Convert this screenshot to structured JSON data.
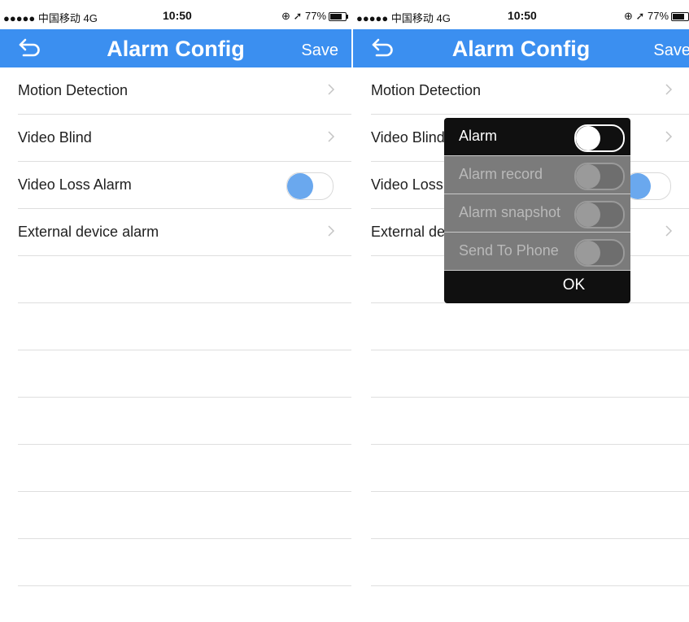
{
  "status_bar": {
    "carrier": "●●●●● 中国移动  4G",
    "time": "10:50",
    "right_text": "⊕ ➚ 77%",
    "battery_level": 0.77
  },
  "nav": {
    "title": "Alarm Config",
    "save_label": "Save",
    "back_icon": "back-arrow-icon",
    "background_color": "#3b8ff0"
  },
  "settings": {
    "motion_detection": "Motion Detection",
    "video_blind": "Video Blind",
    "video_loss_alarm": "Video Loss Alarm",
    "video_loss_alarm_enabled": false,
    "external_device_alarm": "External device alarm"
  },
  "dialog": {
    "alarm_label": "Alarm",
    "alarm_on": false,
    "alarm_record_label": "Alarm record",
    "alarm_snapshot_label": "Alarm snapshot",
    "send_to_phone_label": "Send To Phone",
    "ok_label": "OK"
  }
}
